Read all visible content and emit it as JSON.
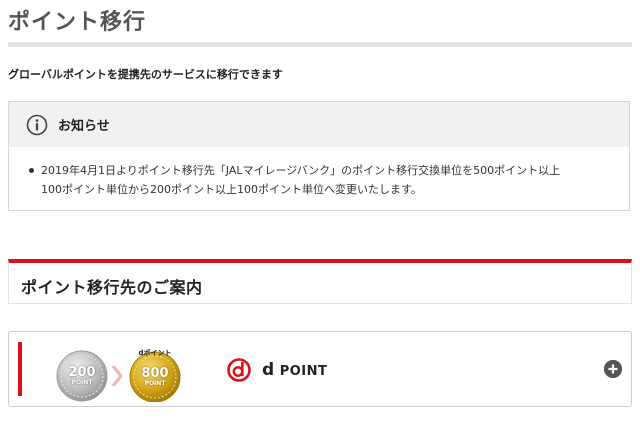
{
  "page": {
    "title": "ポイント移行",
    "intro": "グローバルポイントを提携先のサービスに移行できます"
  },
  "notice": {
    "icon": "info-icon",
    "title": "お知らせ",
    "items": [
      {
        "lines": [
          "2019年4月1日よりポイント移行先「JALマイレージバンク」のポイント移行交換単位を500ポイント以上",
          "100ポイント単位から200ポイント以上100ポイント単位へ変更いたします。"
        ]
      }
    ]
  },
  "section": {
    "title": "ポイント移行先のご案内"
  },
  "partners": [
    {
      "from_coin": {
        "value": "200",
        "unit": "POINT"
      },
      "to_coin": {
        "prefix": "dポイント",
        "value": "800",
        "unit": "POINT"
      },
      "logo_text_d": "d",
      "logo_text": "POINT",
      "expand_icon": "plus-circle-icon"
    }
  ],
  "colors": {
    "accent_red": "#dd0f17",
    "rule_gray": "#e3e3e3",
    "notice_header_bg": "#f2f1ef",
    "title_gray": "#555555"
  }
}
